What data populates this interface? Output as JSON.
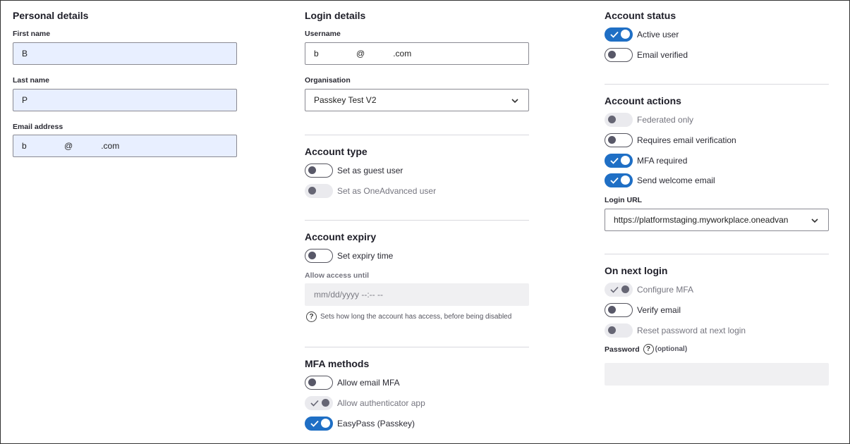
{
  "personal": {
    "title": "Personal details",
    "first_name_label": "First name",
    "first_name_value": "B",
    "last_name_label": "Last name",
    "last_name_value": "P",
    "email_label": "Email address",
    "email_value": "b                @            .com"
  },
  "login": {
    "title": "Login details",
    "username_label": "Username",
    "username_value": "b                @            .com",
    "org_label": "Organisation",
    "org_value": "Passkey Test V2"
  },
  "account_type": {
    "title": "Account type",
    "guest": {
      "label": "Set as guest user",
      "state": "off"
    },
    "oneadvanced": {
      "label": "Set as OneAdvanced user",
      "state": "disabled-off"
    }
  },
  "account_expiry": {
    "title": "Account expiry",
    "expiry": {
      "label": "Set expiry time",
      "state": "off"
    },
    "allow_label": "Allow access until",
    "allow_placeholder": "mm/dd/yyyy --:-- --",
    "help_text": "Sets how long the account has access, before being disabled"
  },
  "mfa_methods": {
    "title": "MFA methods",
    "email": {
      "label": "Allow email MFA",
      "state": "off"
    },
    "authenticator": {
      "label": "Allow authenticator app",
      "state": "disabled-on"
    },
    "easypass": {
      "label": "EasyPass (Passkey)",
      "state": "on"
    }
  },
  "account_status": {
    "title": "Account status",
    "active": {
      "label": "Active user",
      "state": "on"
    },
    "verified": {
      "label": "Email verified",
      "state": "off"
    }
  },
  "account_actions": {
    "title": "Account actions",
    "federated": {
      "label": "Federated only",
      "state": "disabled-off"
    },
    "requires_verification": {
      "label": "Requires email verification",
      "state": "off"
    },
    "mfa_required": {
      "label": "MFA required",
      "state": "on"
    },
    "welcome": {
      "label": "Send welcome email",
      "state": "on"
    },
    "login_url_label": "Login URL",
    "login_url_value": "https://platformstaging.myworkplace.oneadvan"
  },
  "next_login": {
    "title": "On next login",
    "configure_mfa": {
      "label": "Configure MFA",
      "state": "disabled-on"
    },
    "verify_email": {
      "label": "Verify email",
      "state": "off"
    },
    "reset_password": {
      "label": "Reset password at next login",
      "state": "disabled-off"
    },
    "password_label": "Password",
    "password_optional": "(optional)"
  },
  "colors": {
    "accent": "#1f6fc5",
    "filled_input": "#e8efff"
  },
  "icons": {
    "toggle_check": "check-icon",
    "select": "chevron-down-icon",
    "help": "question-circle-icon"
  }
}
